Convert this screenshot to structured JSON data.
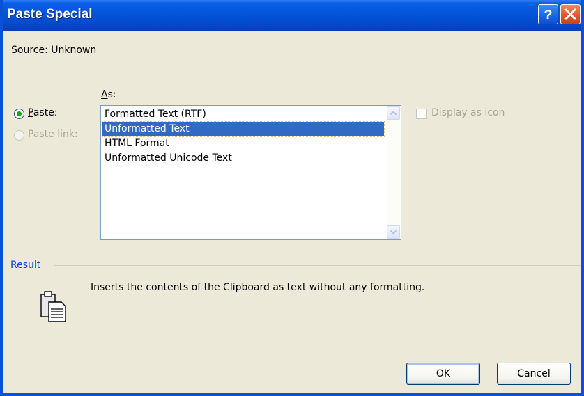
{
  "window": {
    "title": "Paste Special",
    "help_label": "?",
    "close_label": "X"
  },
  "source": {
    "text": "Source:  Unknown"
  },
  "as_label": "As:",
  "paste_options": [
    {
      "label": "Paste:",
      "checked": true,
      "enabled": true
    },
    {
      "label": "Paste link:",
      "checked": false,
      "enabled": false
    }
  ],
  "formats": [
    {
      "label": "Formatted Text (RTF)",
      "selected": false
    },
    {
      "label": "Unformatted Text",
      "selected": true
    },
    {
      "label": "HTML Format",
      "selected": false
    },
    {
      "label": "Unformatted Unicode Text",
      "selected": false
    }
  ],
  "display_as_icon": {
    "label": "Display as icon",
    "checked": false,
    "enabled": false
  },
  "result": {
    "heading": "Result",
    "description": "Inserts the contents of the Clipboard as text without any formatting.",
    "icon": "clipboard-document-icon"
  },
  "buttons": {
    "ok": "OK",
    "cancel": "Cancel"
  },
  "colors": {
    "title_bar": "#0453d8",
    "selection": "#316ac5",
    "result_heading": "#0046d5",
    "dialog_background": "#ece9d8"
  }
}
